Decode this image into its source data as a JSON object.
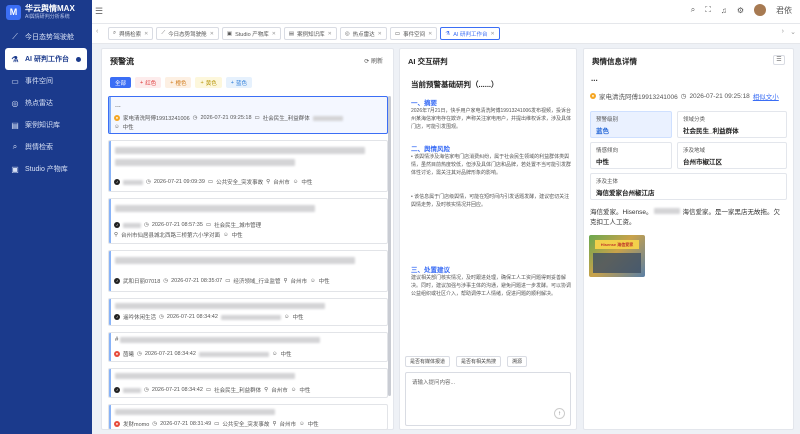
{
  "app": {
    "title": "华云舆情MAX",
    "subtitle": "AI舆情研判分析系统",
    "user": "君依"
  },
  "nav": [
    {
      "label": "今日态势驾驶舱",
      "icon": "chart-line-icon"
    },
    {
      "label": "AI 研判工作台",
      "icon": "flask-icon"
    },
    {
      "label": "事件空间",
      "icon": "folder-icon"
    },
    {
      "label": "热点雷达",
      "icon": "radar-icon"
    },
    {
      "label": "案例知识库",
      "icon": "book-icon"
    },
    {
      "label": "舆情检索",
      "icon": "search-icon"
    },
    {
      "label": "Studio 产物库",
      "icon": "archive-icon"
    }
  ],
  "tabs": [
    "舆情检索",
    "今日态势驾驶舱",
    "Studio 产物库",
    "案例知识库",
    "热点雷达",
    "事件空间",
    "AI 研判工作台"
  ],
  "left": {
    "title": "预警流",
    "refresh": "刷新",
    "chips": [
      "全部",
      "红色",
      "橙色",
      "黄色",
      "蓝色"
    ],
    "cards": [
      {
        "head": "...",
        "source": "家电清洗阿傅19913241006",
        "time": "2026-07-21 09:25:18",
        "tag": "社会民生_利益群体",
        "sent": "中性"
      },
      {
        "head": "",
        "source": "",
        "time": "2026-07-21 09:09:39",
        "tag": "公共安全_突发事故",
        "loc": "台州市",
        "sent": "中性"
      },
      {
        "head": "",
        "source": "",
        "time": "2026-07-21 08:57:35",
        "tag": "社会民生_城市管理",
        "loc": "台州市仙居县城北西路三桥第六小学对面",
        "sent": "中性"
      },
      {
        "head": "",
        "source": "武和日丽07018",
        "time": "2026-07-21 08:35:07",
        "tag": "经济领域_行业监管",
        "loc": "台州市",
        "sent": "中性"
      },
      {
        "head": "",
        "source": "遥吟休闲生活",
        "time": "2026-07-21 08:34:42",
        "tag": "",
        "loc": "",
        "sent": "中性"
      },
      {
        "head": "#",
        "source": "茵曦",
        "time": "2026-07-21 08:34:42",
        "tag": "",
        "loc": "",
        "sent": "中性"
      },
      {
        "head": "",
        "source": "",
        "time": "2026-07-21 08:34:42",
        "tag": "社会民生_利益群体",
        "loc": "台州市",
        "sent": "中性"
      },
      {
        "head": "",
        "source": "发财momo",
        "time": "2026-07-21 08:31:49",
        "tag": "公共安全_突发事故",
        "loc": "台州市",
        "sent": "中性"
      }
    ]
  },
  "ai": {
    "title": "AI 交互研判",
    "report_title": "当前预警基础研判（......）",
    "s1": "一、摘要",
    "s1_text": "2026年7月21日，快手用户家电清洗阿傅19913241006发布视频，投诉台州某海信家电存在欺诈，声称关注家电用户，并提出维权诉求，涉及具体门店，可能引发围观。",
    "s2": "二、舆情风险",
    "b1": "该舆情涉及海信家电门店消费纠纷，属于社会民生领域的利益群体类舆情，虽然目前热度较低，但涉及具体门店和品牌，若处置不当可能引发群体性讨论，需关注其对品牌形象的影响。",
    "b2": "该信息属于门店级舆情，可能在短时间内引发话题发酵，建议密切关注舆情走势，及时核实情况并回应。",
    "s3": "三、处置建议",
    "s3_text": "建议相关部门核实情况，及时跟进处理，确保工人工资问题得到妥善解决。同时，建议加强与涉事主体的沟通，避免问题进一步发酵。可以协调公益组织或社区介入，帮助调停工人情绪，促进问题的顺利解决。",
    "btns": [
      "是否有媒体报道",
      "是否有相关热搜",
      "溯源"
    ],
    "input_placeholder": "请输入提问内容..."
  },
  "detail": {
    "title": "舆情信息详情",
    "dots": "...",
    "source": "家电清洗阿傅19913241006",
    "time": "2026-07-21 09:25:18",
    "link": "相似文小",
    "level_k": "预警级别",
    "level_v": "蓝色",
    "field_k": "领域分类",
    "field_v": "社会民生_利益群体",
    "sent_k": "情感倾向",
    "sent_v": "中性",
    "area_k": "涉及地域",
    "area_v": "台州市椒江区",
    "subject_k": "涉及主体",
    "subject_v": "海信爱家台州椒江店",
    "body_a": "海信爱家。Hisense。",
    "body_b": "海信爱家。是一家黑店无故拖。欠克扣工人工资。",
    "thumb_sign": "Hisense 海信爱家"
  },
  "colors": {
    "primary": "#3b6ef5",
    "sidebar": "#1b3a8c"
  }
}
